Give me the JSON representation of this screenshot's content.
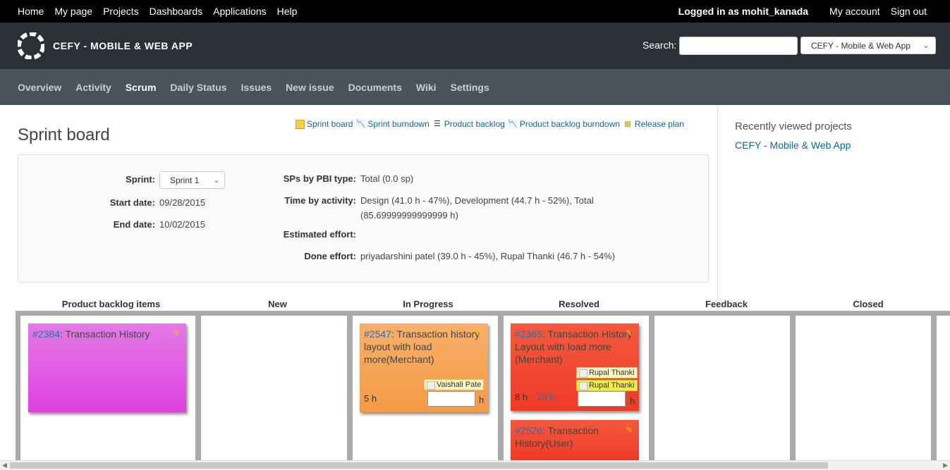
{
  "topbar": {
    "left": [
      "Home",
      "My page",
      "Projects",
      "Dashboards",
      "Applications",
      "Help"
    ],
    "logged_in_as": "Logged in as",
    "user": "mohit_kanada",
    "my_account": "My account",
    "sign_out": "Sign out"
  },
  "header": {
    "project_title": "CEFY - MOBILE & WEB APP",
    "search_label": "Search:",
    "project_jump": "CEFY - Mobile & Web App"
  },
  "menu": [
    "Overview",
    "Activity",
    "Scrum",
    "Daily Status",
    "Issues",
    "New issue",
    "Documents",
    "Wiki",
    "Settings"
  ],
  "menu_active": "Scrum",
  "page_title": "Sprint board",
  "contextual": [
    "Sprint board",
    "Sprint burndown",
    "Product backlog",
    "Product backlog burndown",
    "Release plan"
  ],
  "info": {
    "sprint_label": "Sprint:",
    "sprint_value": "Sprint 1",
    "start_label": "Start date:",
    "start_value": "09/28/2015",
    "end_label": "End date:",
    "end_value": "10/02/2015",
    "sps_label": "SPs by PBI type:",
    "sps_value": "Total (0.0 sp)",
    "time_label": "Time by activity:",
    "time_value_1": "Design (41.0 h - 47%), Development (44.7 h - 52%), Total",
    "time_value_2": "(85.69999999999999 h)",
    "est_label": "Estimated effort:",
    "done_label": "Done effort:",
    "done_value": "priyadarshini patel (39.0 h - 45%), Rupal Thanki (46.7 h - 54%)"
  },
  "sidebar": {
    "title": "Recently viewed projects",
    "link": "CEFY - Mobile & Web App"
  },
  "board": {
    "columns": [
      "Product backlog items",
      "New",
      "In Progress",
      "Resolved",
      "Feedback",
      "Closed"
    ],
    "cards": [
      {
        "id": "#2384",
        "title": ": Transaction History",
        "color": "#e050e8"
      },
      {
        "id": "#2547",
        "title": ": Transaction history layout with load more(Merchant)",
        "assignee": "Vaishali Pate",
        "hours": "5 h",
        "unit": "h",
        "color": "#f5a650"
      },
      {
        "id": "#2385",
        "title": ": Transaction History Layout with load more (Merchant)",
        "assignee1": "Rupal Thanki",
        "assignee2": "Rupal Thanki",
        "hours": "8 h",
        "remaining": "10 h",
        "unit": "h",
        "color": "#f04a32"
      },
      {
        "id": "#2526",
        "title": ": Transaction History(User)",
        "color": "#f04a32"
      }
    ]
  },
  "colors": {
    "topbar": "#000000",
    "header": "#2b3036",
    "menu": "#4a525a",
    "link": "#116699"
  }
}
